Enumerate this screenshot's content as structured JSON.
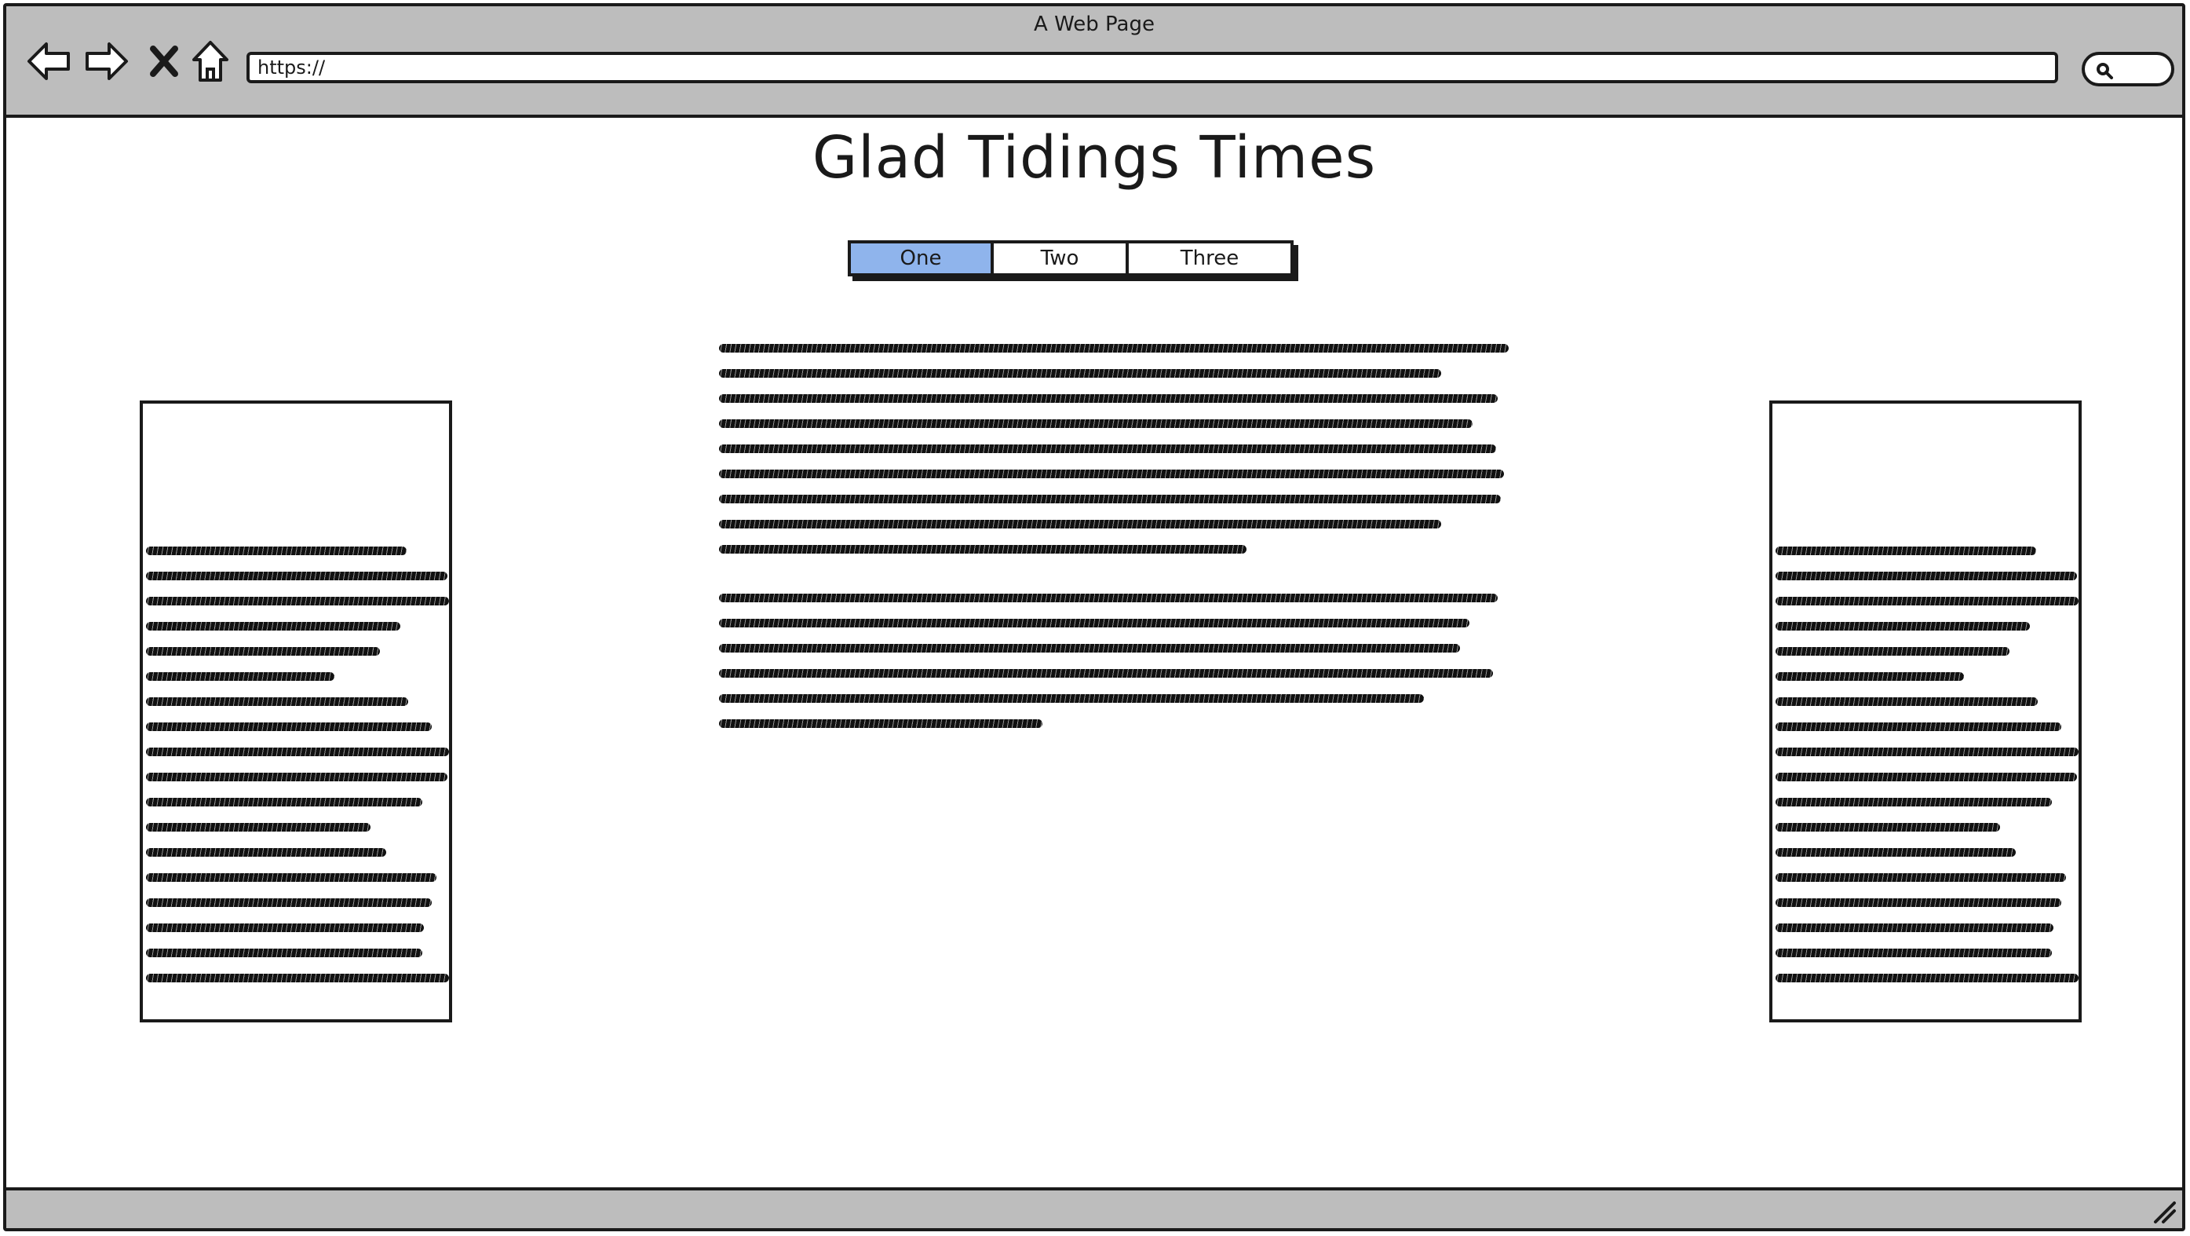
{
  "window": {
    "title": "A Web Page"
  },
  "toolbar": {
    "back_icon": "arrow-left-icon",
    "forward_icon": "arrow-right-icon",
    "stop_icon": "close-icon",
    "home_icon": "home-icon",
    "url_value": "https://",
    "search_icon": "search-icon"
  },
  "page": {
    "heading": "Glad Tidings Times",
    "tabs": [
      {
        "label": "One",
        "active": true
      },
      {
        "label": "Two",
        "active": false
      },
      {
        "label": "Three",
        "active": false
      }
    ]
  },
  "colors": {
    "chrome": "#bdbdbd",
    "active_tab": "#8fb4ec",
    "stroke": "#1a1a1a"
  }
}
